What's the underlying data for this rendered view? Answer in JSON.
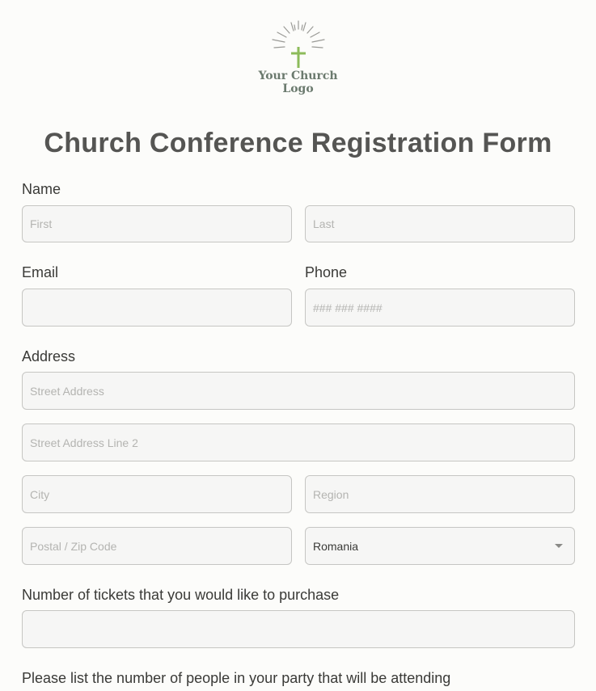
{
  "logo": {
    "line1": "Your Church",
    "line2": "Logo",
    "accent": "#8dbb5a",
    "ray_color": "#9a9a96"
  },
  "form": {
    "title": "Church Conference Registration Form",
    "name": {
      "label": "Name",
      "first_placeholder": "First",
      "last_placeholder": "Last"
    },
    "email": {
      "label": "Email",
      "value": ""
    },
    "phone": {
      "label": "Phone",
      "placeholder": "### ### ####"
    },
    "address": {
      "label": "Address",
      "street_placeholder": "Street Address",
      "street2_placeholder": "Street Address Line 2",
      "city_placeholder": "City",
      "region_placeholder": "Region",
      "postal_placeholder": "Postal / Zip Code",
      "country_selected": "Romania"
    },
    "tickets": {
      "label": "Number of tickets that you would like to purchase",
      "value": ""
    },
    "party": {
      "label": "Please list the number of people in your party that will be attending"
    }
  }
}
